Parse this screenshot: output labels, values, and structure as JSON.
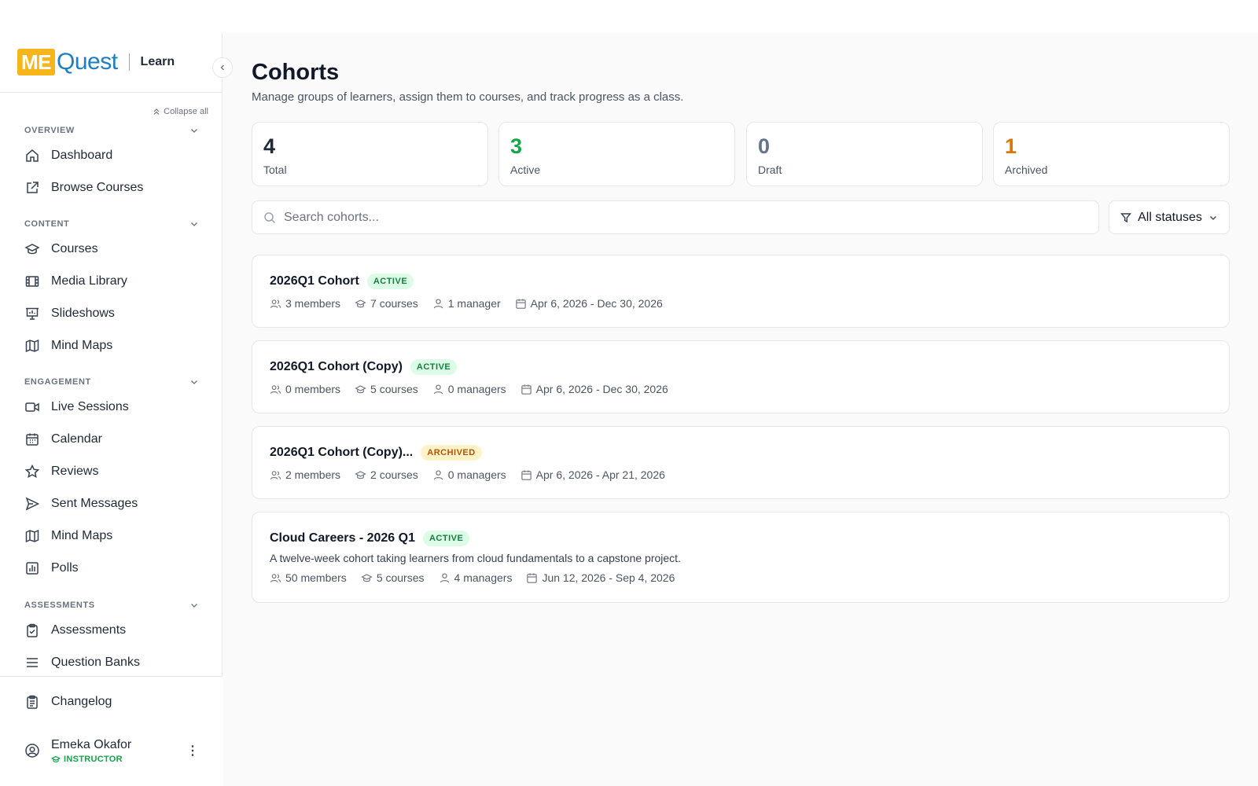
{
  "app": {
    "logo_me": "ME",
    "logo_quest": "Quest",
    "brand_section": "Learn"
  },
  "sidebar": {
    "collapse_all": "Collapse all",
    "sections": [
      {
        "title": "OVERVIEW",
        "items": [
          {
            "label": "Dashboard",
            "icon": "home-icon"
          },
          {
            "label": "Browse Courses",
            "icon": "external-link-icon"
          }
        ]
      },
      {
        "title": "CONTENT",
        "items": [
          {
            "label": "Courses",
            "icon": "graduation-cap-icon"
          },
          {
            "label": "Media Library",
            "icon": "film-icon"
          },
          {
            "label": "Slideshows",
            "icon": "presentation-icon"
          },
          {
            "label": "Mind Maps",
            "icon": "map-icon"
          }
        ]
      },
      {
        "title": "ENGAGEMENT",
        "items": [
          {
            "label": "Live Sessions",
            "icon": "video-icon"
          },
          {
            "label": "Calendar",
            "icon": "calendar-icon"
          },
          {
            "label": "Reviews",
            "icon": "star-icon"
          },
          {
            "label": "Sent Messages",
            "icon": "send-icon"
          },
          {
            "label": "Mind Maps",
            "icon": "map-icon"
          },
          {
            "label": "Polls",
            "icon": "bar-chart-icon"
          }
        ]
      },
      {
        "title": "ASSESSMENTS",
        "items": [
          {
            "label": "Assessments",
            "icon": "clipboard-check-icon"
          },
          {
            "label": "Question Banks",
            "icon": "list-icon"
          }
        ]
      }
    ],
    "changelog": "Changelog",
    "user": {
      "name": "Emeka Okafor",
      "role": "INSTRUCTOR"
    }
  },
  "page": {
    "title": "Cohorts",
    "subtitle": "Manage groups of learners, assign them to courses, and track progress as a class."
  },
  "stats": [
    {
      "value": "4",
      "label": "Total",
      "color": "#1f2937"
    },
    {
      "value": "3",
      "label": "Active",
      "color": "#16a34a"
    },
    {
      "value": "0",
      "label": "Draft",
      "color": "#64748b"
    },
    {
      "value": "1",
      "label": "Archived",
      "color": "#d97706"
    }
  ],
  "search": {
    "placeholder": "Search cohorts..."
  },
  "filter": {
    "selected": "All statuses"
  },
  "cohorts": [
    {
      "name": "2026Q1 Cohort",
      "status": "ACTIVE",
      "members": "3 members",
      "courses": "7 courses",
      "managers": "1 manager",
      "dates": "Apr 6, 2026 - Dec 30, 2026"
    },
    {
      "name": "2026Q1 Cohort (Copy)",
      "status": "ACTIVE",
      "members": "0 members",
      "courses": "5 courses",
      "managers": "0 managers",
      "dates": "Apr 6, 2026 - Dec 30, 2026"
    },
    {
      "name": "2026Q1 Cohort (Copy)...",
      "status": "ARCHIVED",
      "members": "2 members",
      "courses": "2 courses",
      "managers": "0 managers",
      "dates": "Apr 6, 2026 - Apr 21, 2026"
    },
    {
      "name": "Cloud Careers - 2026 Q1",
      "status": "ACTIVE",
      "description": "A twelve-week cohort taking learners from cloud fundamentals to a capstone project.",
      "members": "50 members",
      "courses": "5 courses",
      "managers": "4 managers",
      "dates": "Jun 12, 2026 - Sep 4, 2026"
    }
  ]
}
